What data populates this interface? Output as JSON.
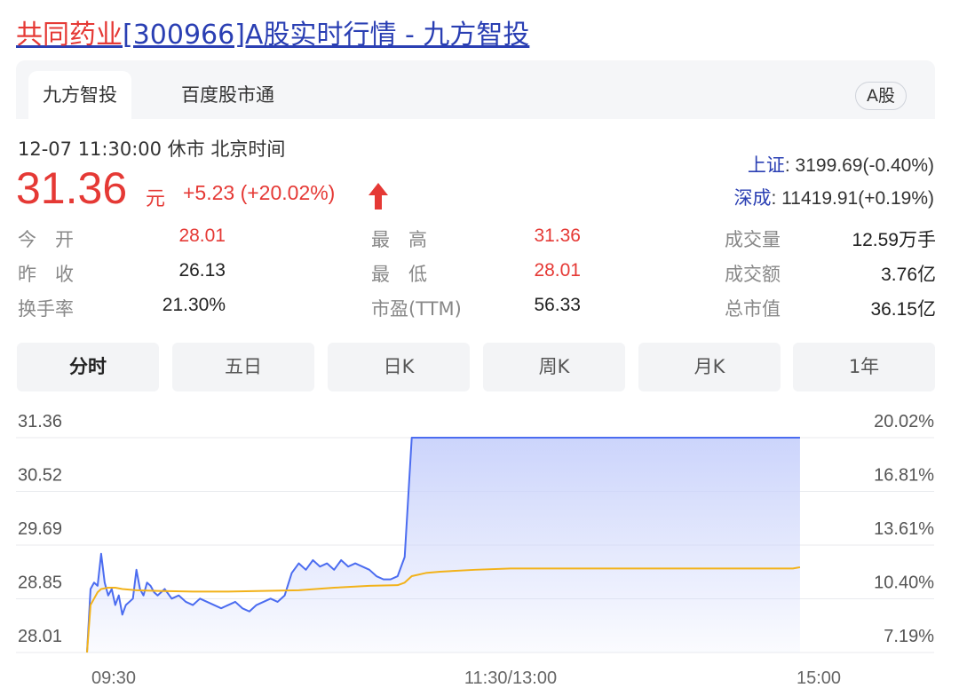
{
  "page_title": {
    "stock_name": "共同药业",
    "rest": "[300966]A股实时行情 - 九方智投"
  },
  "tabs": [
    {
      "label": "九方智投",
      "active": true
    },
    {
      "label": "百度股市通",
      "active": false
    }
  ],
  "market_badge": "A股",
  "quote": {
    "timestamp": "12-07 11:30:00  休市  北京时间",
    "price": "31.36",
    "unit": "元",
    "change": "+5.23 (+20.02%)",
    "direction": "up"
  },
  "indices": [
    {
      "name": "上证",
      "value": ": 3199.69(-0.40%)"
    },
    {
      "name": "深成",
      "value": ": 11419.91(+0.19%)"
    }
  ],
  "stats": [
    {
      "label": "今　开",
      "value": "28.01",
      "color": "red"
    },
    {
      "label": "最　高",
      "value": "31.36",
      "color": "red"
    },
    {
      "label": "成交量",
      "value": "12.59万手",
      "color": "dark"
    },
    {
      "label": "昨　收",
      "value": "26.13",
      "color": "dark"
    },
    {
      "label": "最　低",
      "value": "28.01",
      "color": "red"
    },
    {
      "label": "成交额",
      "value": "3.76亿",
      "color": "dark"
    },
    {
      "label": "换手率",
      "value": "21.30%",
      "color": "dark"
    },
    {
      "label": "市盈(TTM)",
      "value": "56.33",
      "color": "dark"
    },
    {
      "label": "总市值",
      "value": "36.15亿",
      "color": "dark"
    }
  ],
  "periods": [
    {
      "label": "分时",
      "active": true
    },
    {
      "label": "五日",
      "active": false
    },
    {
      "label": "日K",
      "active": false
    },
    {
      "label": "周K",
      "active": false
    },
    {
      "label": "月K",
      "active": false
    },
    {
      "label": "1年",
      "active": false
    }
  ],
  "colors": {
    "up_red": "#e53935",
    "link_blue": "#2a3fb3",
    "price_line": "#4b6cf0",
    "avg_line": "#f2b21a",
    "area_fill_top": "#c9d2fb"
  },
  "chart_data": {
    "type": "line",
    "title": "",
    "y_ticks": [
      "31.36",
      "30.52",
      "29.69",
      "28.85",
      "28.01"
    ],
    "y_right_ticks": [
      "20.02%",
      "16.81%",
      "13.61%",
      "10.40%",
      "7.19%"
    ],
    "ylim": [
      28.01,
      31.36
    ],
    "x_ticks": [
      "09:30",
      "11:30/13:00",
      "15:00"
    ],
    "x_minutes_range": [
      0,
      240
    ],
    "grid": true,
    "series": [
      {
        "kind": "price",
        "x": [
          0,
          1,
          2,
          3,
          4,
          5,
          6,
          7,
          8,
          9,
          10,
          11,
          12,
          13,
          14,
          15,
          16,
          17,
          18,
          19,
          20,
          22,
          24,
          26,
          28,
          30,
          32,
          34,
          36,
          38,
          40,
          42,
          44,
          46,
          48,
          50,
          52,
          54,
          56,
          58,
          60,
          62,
          64,
          66,
          68,
          70,
          72,
          74,
          76,
          78,
          80,
          82,
          84,
          86,
          88,
          90,
          92,
          94,
          96,
          98,
          100,
          102,
          104,
          106,
          110,
          120,
          140,
          160,
          180,
          200,
          202
        ],
        "y": [
          28.01,
          29.0,
          29.1,
          29.05,
          29.55,
          29.1,
          28.9,
          29.0,
          28.75,
          28.9,
          28.6,
          28.75,
          28.8,
          28.85,
          29.3,
          29.0,
          28.9,
          29.1,
          29.05,
          28.95,
          28.9,
          29.0,
          28.85,
          28.9,
          28.8,
          28.75,
          28.85,
          28.8,
          28.75,
          28.7,
          28.75,
          28.8,
          28.7,
          28.65,
          28.75,
          28.8,
          28.85,
          28.8,
          28.9,
          29.25,
          29.4,
          29.3,
          29.45,
          29.35,
          29.4,
          29.3,
          29.45,
          29.35,
          29.4,
          29.35,
          29.3,
          29.2,
          29.15,
          29.15,
          29.2,
          29.5,
          31.36,
          31.36,
          31.36,
          31.36,
          31.36,
          31.36,
          31.36,
          31.36,
          31.36,
          31.36,
          31.36,
          31.36,
          31.36,
          31.36,
          31.36
        ]
      },
      {
        "kind": "average",
        "x": [
          0,
          1,
          2,
          3,
          4,
          6,
          8,
          10,
          14,
          20,
          30,
          40,
          50,
          60,
          70,
          80,
          88,
          90,
          92,
          96,
          100,
          110,
          120,
          140,
          160,
          180,
          200,
          202
        ],
        "y": [
          28.01,
          28.75,
          28.85,
          28.95,
          29.0,
          29.02,
          29.02,
          29.0,
          28.98,
          28.97,
          28.96,
          28.96,
          28.97,
          28.98,
          29.02,
          29.05,
          29.06,
          29.1,
          29.2,
          29.25,
          29.27,
          29.3,
          29.32,
          29.32,
          29.32,
          29.32,
          29.32,
          29.34
        ]
      }
    ]
  }
}
